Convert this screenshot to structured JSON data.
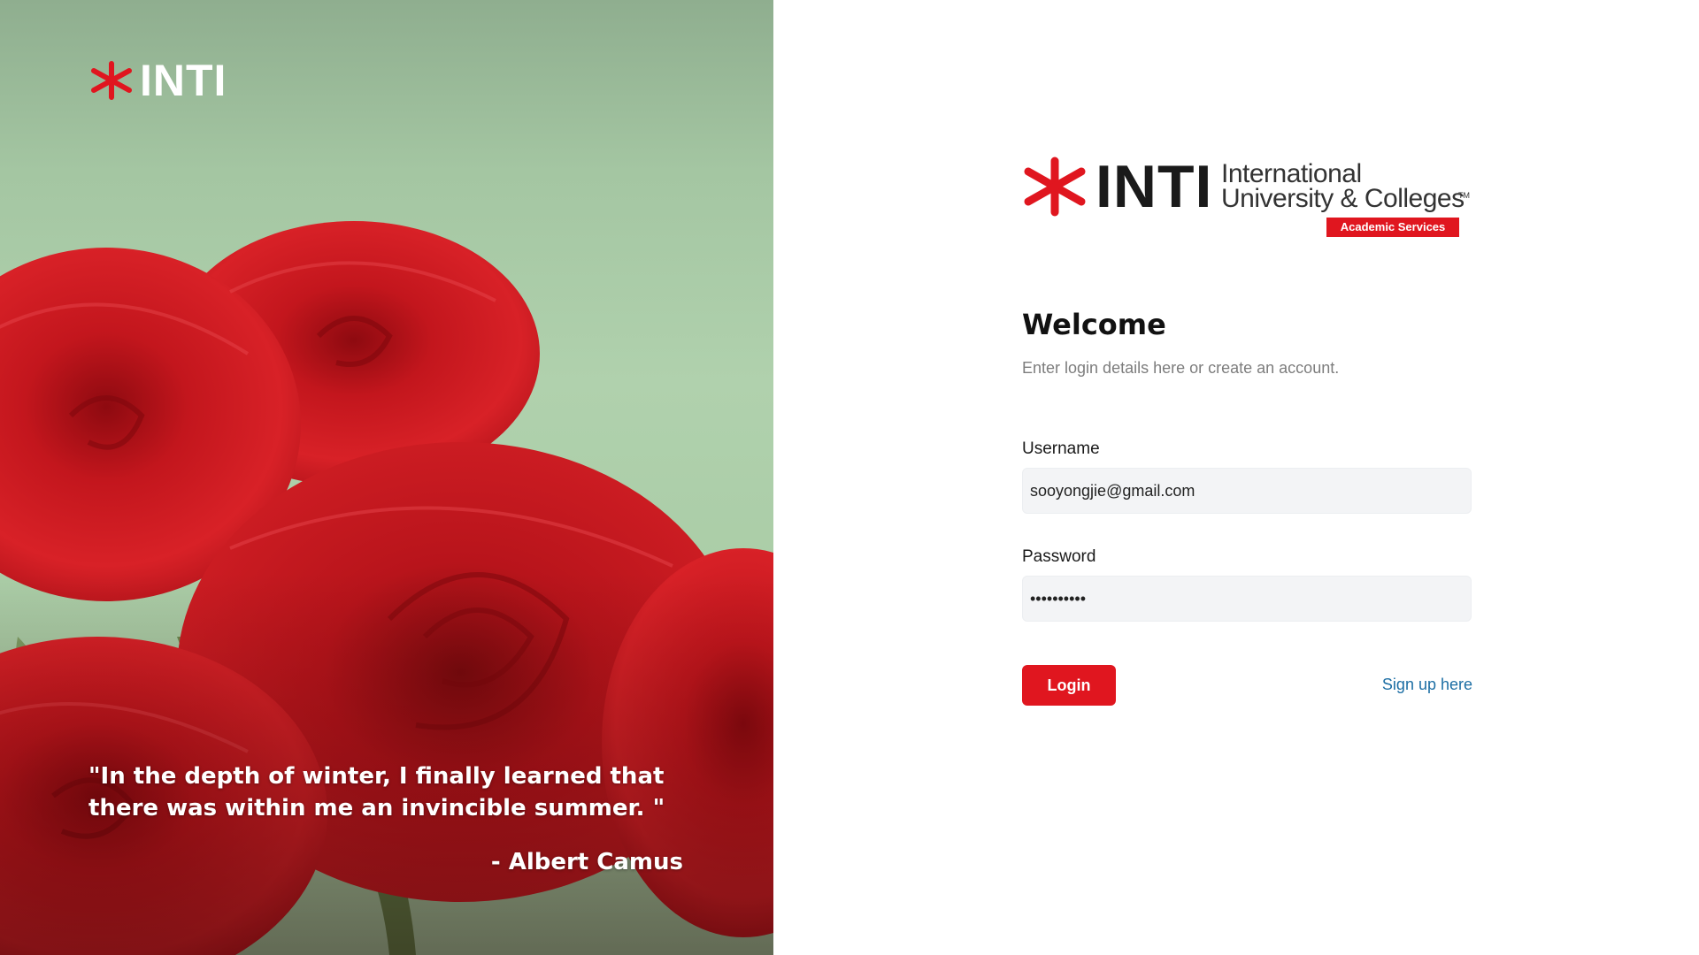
{
  "hero": {
    "logo_text": "INTI",
    "quote": "\"In the depth of winter, I finally learned that there was within me an invincible summer. \"",
    "author": "- Albert Camus"
  },
  "brand": {
    "inti": "INTI",
    "line1": "International",
    "line2": "University & Colleges",
    "tm": "TM",
    "badge": "Academic Services",
    "accent_color": "#e0161f"
  },
  "login": {
    "title": "Welcome",
    "subtitle": "Enter login details here or create an account.",
    "username_label": "Username",
    "username_value": "sooyongjie@gmail.com",
    "password_label": "Password",
    "password_value": "••••••••••",
    "login_button": "Login",
    "signup_link": "Sign up here",
    "link_color": "#1c6ea4"
  }
}
